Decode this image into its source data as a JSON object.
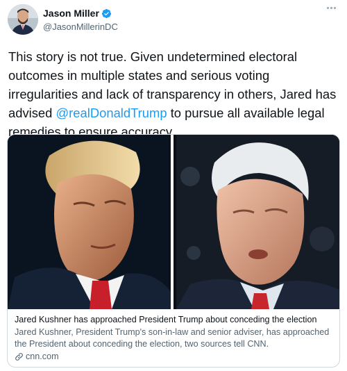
{
  "author": {
    "display_name": "Jason Miller",
    "handle": "@JasonMillerinDC",
    "verified_color": "#1d9bf0"
  },
  "tweet": {
    "text_before": "This story is not true. Given undetermined electoral outcomes in multiple states and serious voting irregularities and lack of transparency in others, Jared has advised ",
    "mention": "@realDonaldTrump",
    "text_after": " to pursue all available legal remedies to ensure accuracy."
  },
  "card": {
    "title": "Jared Kushner has approached President Trump about conceding the election",
    "description": "Jared Kushner, President Trump's son-in-law and senior adviser, has approached the President about conceding the election, two sources tell CNN.",
    "domain": "cnn.com",
    "left_image_icon": "portrait-photo-icon",
    "right_image_icon": "portrait-photo-icon"
  },
  "colors": {
    "link": "#1d9bf0",
    "text": "#0f1419",
    "secondary": "#536471",
    "border": "#cfd9de"
  }
}
